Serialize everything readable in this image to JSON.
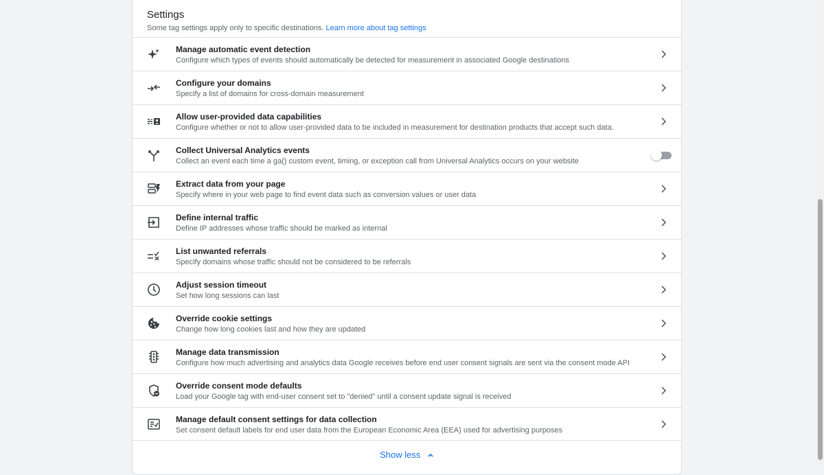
{
  "header": {
    "title": "Settings",
    "subtitle": "Some tag settings apply only to specific destinations.",
    "link": "Learn more about tag settings"
  },
  "settings": [
    {
      "title": "Manage automatic event detection",
      "desc": "Configure which types of events should automatically be detected for measurement in associated Google destinations",
      "icon": "sparkle-icon",
      "control": "chevron"
    },
    {
      "title": "Configure your domains",
      "desc": "Specify a list of domains for cross-domain measurement",
      "icon": "merge-arrows-icon",
      "control": "chevron"
    },
    {
      "title": "Allow user-provided data capabilities",
      "desc": "Configure whether or not to allow user-provided data to be included in measurement for destination products that accept such data.",
      "icon": "user-data-icon",
      "control": "chevron"
    },
    {
      "title": "Collect Universal Analytics events",
      "desc": "Collect an event each time a ga() custom event, timing, or exception call from Universal Analytics occurs on your website",
      "icon": "fork-icon",
      "control": "toggle",
      "enabled": false
    },
    {
      "title": "Extract data from your page",
      "desc": "Specify where in your web page to find event data such as conversion values or user data",
      "icon": "extract-icon",
      "control": "chevron"
    },
    {
      "title": "Define internal traffic",
      "desc": "Define IP addresses whose traffic should be marked as internal",
      "icon": "login-icon",
      "control": "chevron"
    },
    {
      "title": "List unwanted referrals",
      "desc": "Specify domains whose traffic should not be considered to be referrals",
      "icon": "rule-list-icon",
      "control": "chevron"
    },
    {
      "title": "Adjust session timeout",
      "desc": "Set how long sessions can last",
      "icon": "clock-icon",
      "control": "chevron"
    },
    {
      "title": "Override cookie settings",
      "desc": "Change how long cookies last and how they are updated",
      "icon": "cookie-icon",
      "control": "chevron"
    },
    {
      "title": "Manage data transmission",
      "desc": "Configure how much advertising and analytics data Google receives before end user consent signals are sent via the consent mode API",
      "icon": "traffic-light-icon",
      "control": "chevron"
    },
    {
      "title": "Override consent mode defaults",
      "desc": "Load your Google tag with end-user consent set to \"denied\" until a consent update signal is received",
      "icon": "shield-minus-icon",
      "control": "chevron"
    },
    {
      "title": "Manage default consent settings for data collection",
      "desc": "Set consent default labels for end user data from the European Economic Area (EEA) used for advertising purposes",
      "icon": "checklist-icon",
      "control": "chevron"
    }
  ],
  "footer": {
    "show_less": "Show less"
  },
  "colors": {
    "link": "#1a73e8",
    "text": "#202124",
    "secondary": "#5f6368",
    "icon": "#3c4043"
  }
}
